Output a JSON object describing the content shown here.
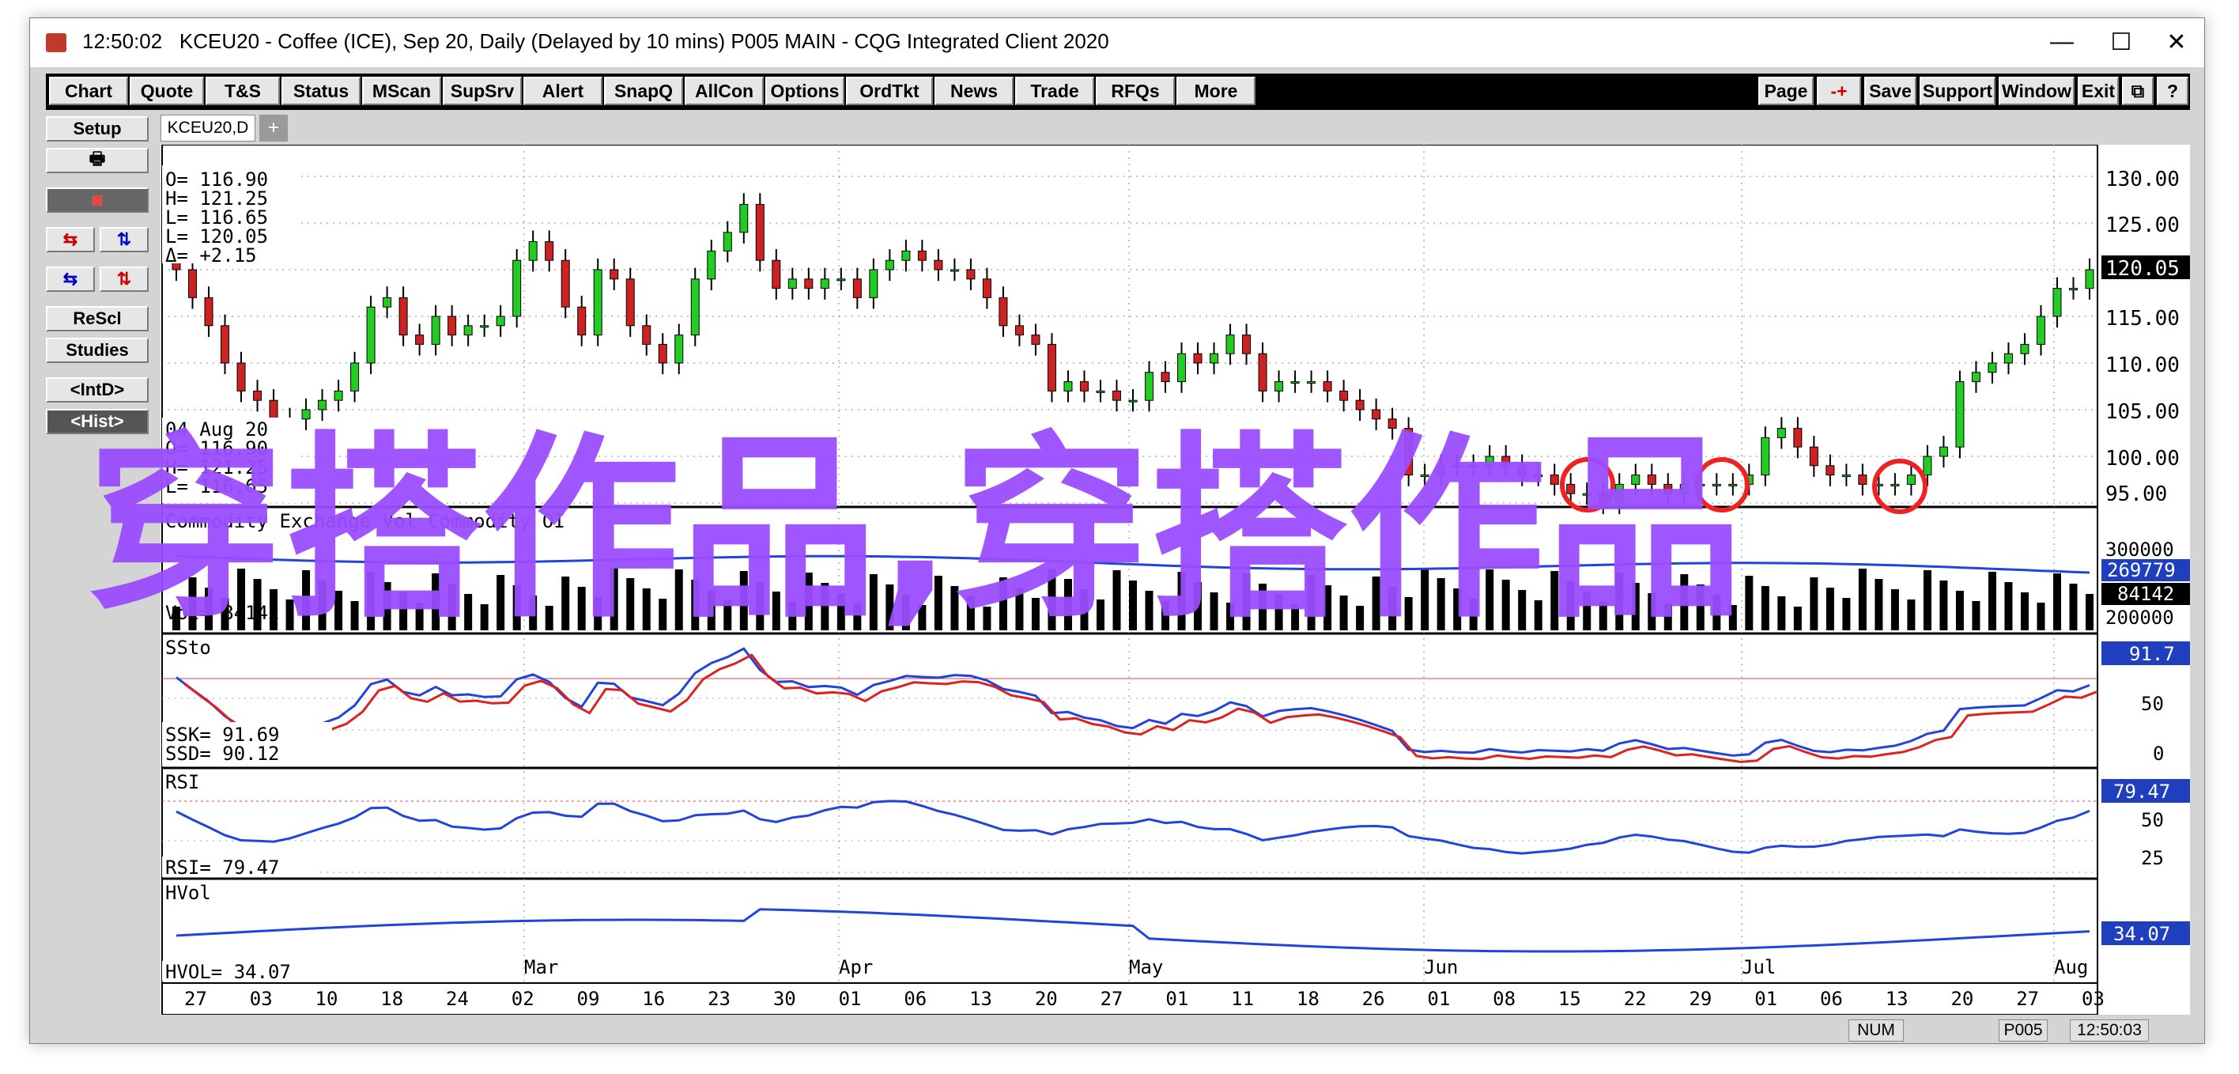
{
  "window": {
    "time": "12:50:02",
    "title": "KCEU20 - Coffee (ICE), Sep 20, Daily (Delayed by 10 mins)   P005 MAIN - CQG Integrated Client 2020",
    "minimize": "—",
    "maximize": "☐",
    "close": "✕"
  },
  "menu_left": [
    "Chart",
    "Quote",
    "T&S",
    "Status",
    "MScan",
    "SupSrv",
    "Alert",
    "SnapQ",
    "AllCon",
    "Options",
    "OrdTkt",
    "News",
    "Trade",
    "RFQs",
    "More"
  ],
  "menu_right": [
    "Page",
    "-+",
    "Save",
    "Support",
    "Window",
    "Exit",
    "⧉",
    "?"
  ],
  "sidebar": {
    "setup": "Setup",
    "print": "🖶",
    "tool": "◙",
    "arrows1a": "⇆",
    "arrows1b": "⇅",
    "arrows2a": "⇆",
    "arrows2b": "⇅",
    "rescl": "ReScl",
    "studies": "Studies",
    "intd": "<IntD>",
    "hist": "<Hist>"
  },
  "tabs": {
    "active": "KCEU20,D",
    "add": "+"
  },
  "watermark": "穿搭作品,穿搭作品",
  "status": {
    "num": "NUM",
    "page": "P005",
    "time": "12:50:03"
  },
  "colors": {
    "up": "#22cc22",
    "down": "#cc2222",
    "blue": "#2244dd",
    "red": "#dd2222",
    "bg": "#ffffff"
  },
  "chart_data": {
    "type": "candlestick",
    "price_panel": {
      "ohlc_box": [
        "O=  116.90",
        "H=  121.25",
        "L=  116.65",
        "L=  120.05",
        "Δ=   +2.15"
      ],
      "hist_box": [
        "04 Aug 20",
        "O=   116.90",
        "H=   121.25",
        "L=   116.65"
      ],
      "y_ticks": [
        "130.00",
        "125.00",
        "120.00",
        "115.00",
        "110.00",
        "105.00",
        "100.00",
        "95.00"
      ],
      "last_price": "120.05",
      "closes": [
        120,
        117,
        114,
        110,
        107,
        106,
        104,
        104,
        105,
        106,
        107,
        110,
        116,
        117,
        113,
        112,
        115,
        113,
        114,
        114,
        115,
        121,
        123,
        121,
        116,
        113,
        120,
        119,
        114,
        112,
        110,
        113,
        119,
        122,
        124,
        127,
        121,
        118,
        119,
        118,
        119,
        119,
        117,
        120,
        121,
        122,
        121,
        120,
        120,
        119,
        117,
        114,
        113,
        112,
        107,
        108,
        107,
        107,
        106,
        106,
        109,
        108,
        111,
        110,
        111,
        113,
        111,
        107,
        108,
        108,
        108,
        107,
        106,
        105,
        104,
        103,
        98,
        98,
        99,
        99,
        99,
        100,
        99,
        98,
        98,
        97,
        96,
        96,
        95,
        97,
        98,
        97,
        96,
        97,
        97,
        97,
        97,
        98,
        102,
        103,
        101,
        99,
        98,
        98,
        97,
        97,
        97,
        98,
        100,
        101,
        108,
        109,
        110,
        111,
        112,
        115,
        118,
        118,
        120
      ]
    },
    "volume_panel": {
      "label": "Commodity Exchange Vol   Commodity OI",
      "vol_label": "Vol=    84142",
      "y_ticks": [
        "300000",
        "200000"
      ],
      "oi_value": "269779",
      "vol_value": "84142"
    },
    "stoch_panel": {
      "label": "SSto",
      "ssk": "SSK=    91.69",
      "ssd": "SSD=    90.12",
      "y_ticks": [
        "50",
        "0"
      ],
      "value": "91.7"
    },
    "rsi_panel": {
      "label": "RSI",
      "rsi": "RSI=     79.47",
      "y_ticks": [
        "50",
        "25"
      ],
      "value": "79.47"
    },
    "hvol_panel": {
      "label": "HVol",
      "hvol": "HVOL=    34.07",
      "value": "34.07"
    },
    "x_months": [
      "Mar",
      "Apr",
      "May",
      "Jun",
      "Jul",
      "Aug"
    ],
    "x_days": [
      "27",
      "03",
      "10",
      "18",
      "24",
      "02",
      "09",
      "16",
      "23",
      "30",
      "01",
      "06",
      "13",
      "20",
      "27",
      "01",
      "11",
      "18",
      "26",
      "01",
      "08",
      "15",
      "22",
      "29",
      "01",
      "06",
      "13",
      "20",
      "27",
      "03"
    ]
  }
}
